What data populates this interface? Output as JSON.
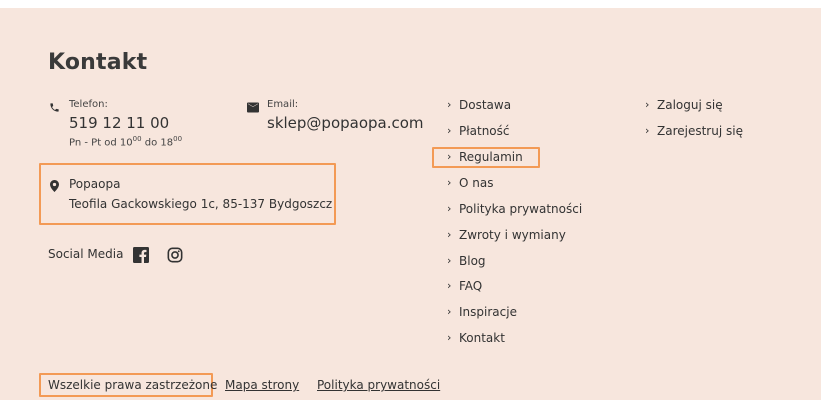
{
  "footer": {
    "heading": "Kontakt",
    "phone": {
      "label": "Telefon:",
      "value": "519 12 11 00",
      "hours_prefix": "Pn - Pt od 10",
      "hours_sup1": "00",
      "hours_mid": " do 18",
      "hours_sup2": "00"
    },
    "email": {
      "label": "Email:",
      "value": "sklep@popaopa.com"
    },
    "address": {
      "name": "Popaopa",
      "street": "Teofila Gackowskiego 1c, 85-137 Bydgoszcz"
    },
    "social": {
      "label": "Social Media",
      "icons": [
        "facebook-icon",
        "instagram-icon"
      ]
    },
    "nav_main": [
      {
        "label": "Dostawa"
      },
      {
        "label": "Płatność"
      },
      {
        "label": "Regulamin"
      },
      {
        "label": "O nas"
      },
      {
        "label": "Polityka prywatności"
      },
      {
        "label": "Zwroty i wymiany"
      },
      {
        "label": "Blog"
      },
      {
        "label": "FAQ"
      },
      {
        "label": "Inspiracje"
      },
      {
        "label": "Kontakt"
      }
    ],
    "nav_account": [
      {
        "label": "Zaloguj się"
      },
      {
        "label": "Zarejestruj się"
      }
    ],
    "bottom": {
      "rights": "Wszelkie prawa zastrzeżone",
      "sitemap": "Mapa strony",
      "privacy": "Polityka prywatności"
    }
  },
  "colors": {
    "background": "#f7e6dd",
    "highlight": "#f39a55",
    "text": "#3a3a3a"
  }
}
